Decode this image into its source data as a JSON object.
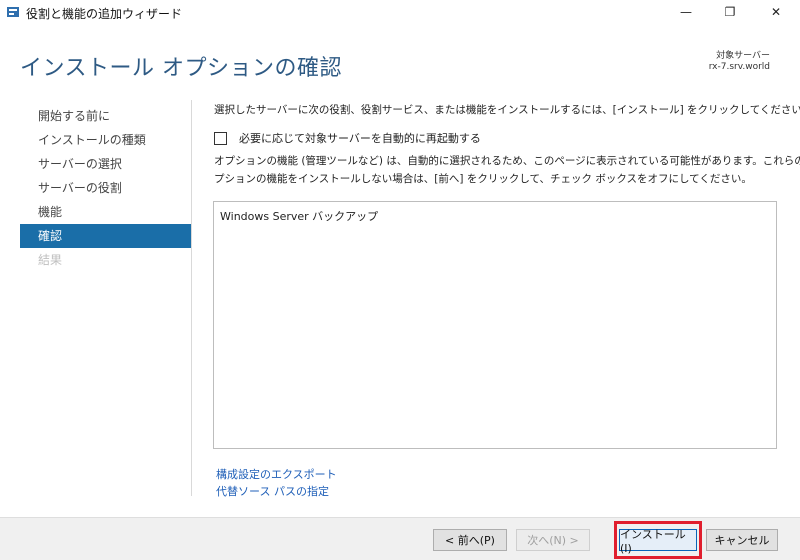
{
  "window": {
    "title": "役割と機能の追加ウィザード",
    "minimize_glyph": "—",
    "maximize_glyph": "❐",
    "close_glyph": "✕"
  },
  "header": {
    "title": "インストール オプションの確認",
    "target_server_label": "対象サーバー",
    "target_server_value": "rx-7.srv.world"
  },
  "sidebar": {
    "items": [
      {
        "label": "開始する前に",
        "state": "normal"
      },
      {
        "label": "インストールの種類",
        "state": "normal"
      },
      {
        "label": "サーバーの選択",
        "state": "normal"
      },
      {
        "label": "サーバーの役割",
        "state": "normal"
      },
      {
        "label": "機能",
        "state": "normal"
      },
      {
        "label": "確認",
        "state": "active"
      },
      {
        "label": "結果",
        "state": "disabled"
      }
    ]
  },
  "main": {
    "intro": "選択したサーバーに次の役割、役割サービス、または機能をインストールするには、[インストール] をクリックしてください。",
    "restart_checkbox_label": "必要に応じて対象サーバーを自動的に再起動する",
    "restart_checked": false,
    "description_line1": "オプションの機能 (管理ツールなど) は、自動的に選択されるため、このページに表示されている可能性があります。これらのオ",
    "description_line2": "プションの機能をインストールしない場合は、[前へ] をクリックして、チェック ボックスをオフにしてください。",
    "features": [
      "Windows Server バックアップ"
    ],
    "links": {
      "export": "構成設定のエクスポート",
      "alternate_source": "代替ソース パスの指定"
    }
  },
  "footer": {
    "prev_label": "< 前へ(P)",
    "next_label": "次へ(N) >",
    "install_label": "インストール(I)",
    "cancel_label": "キャンセル"
  },
  "colors": {
    "accent": "#1a6ea8",
    "title_blue": "#2e5a84",
    "highlight_red": "#e01e2d",
    "link": "#1f5fb8"
  }
}
